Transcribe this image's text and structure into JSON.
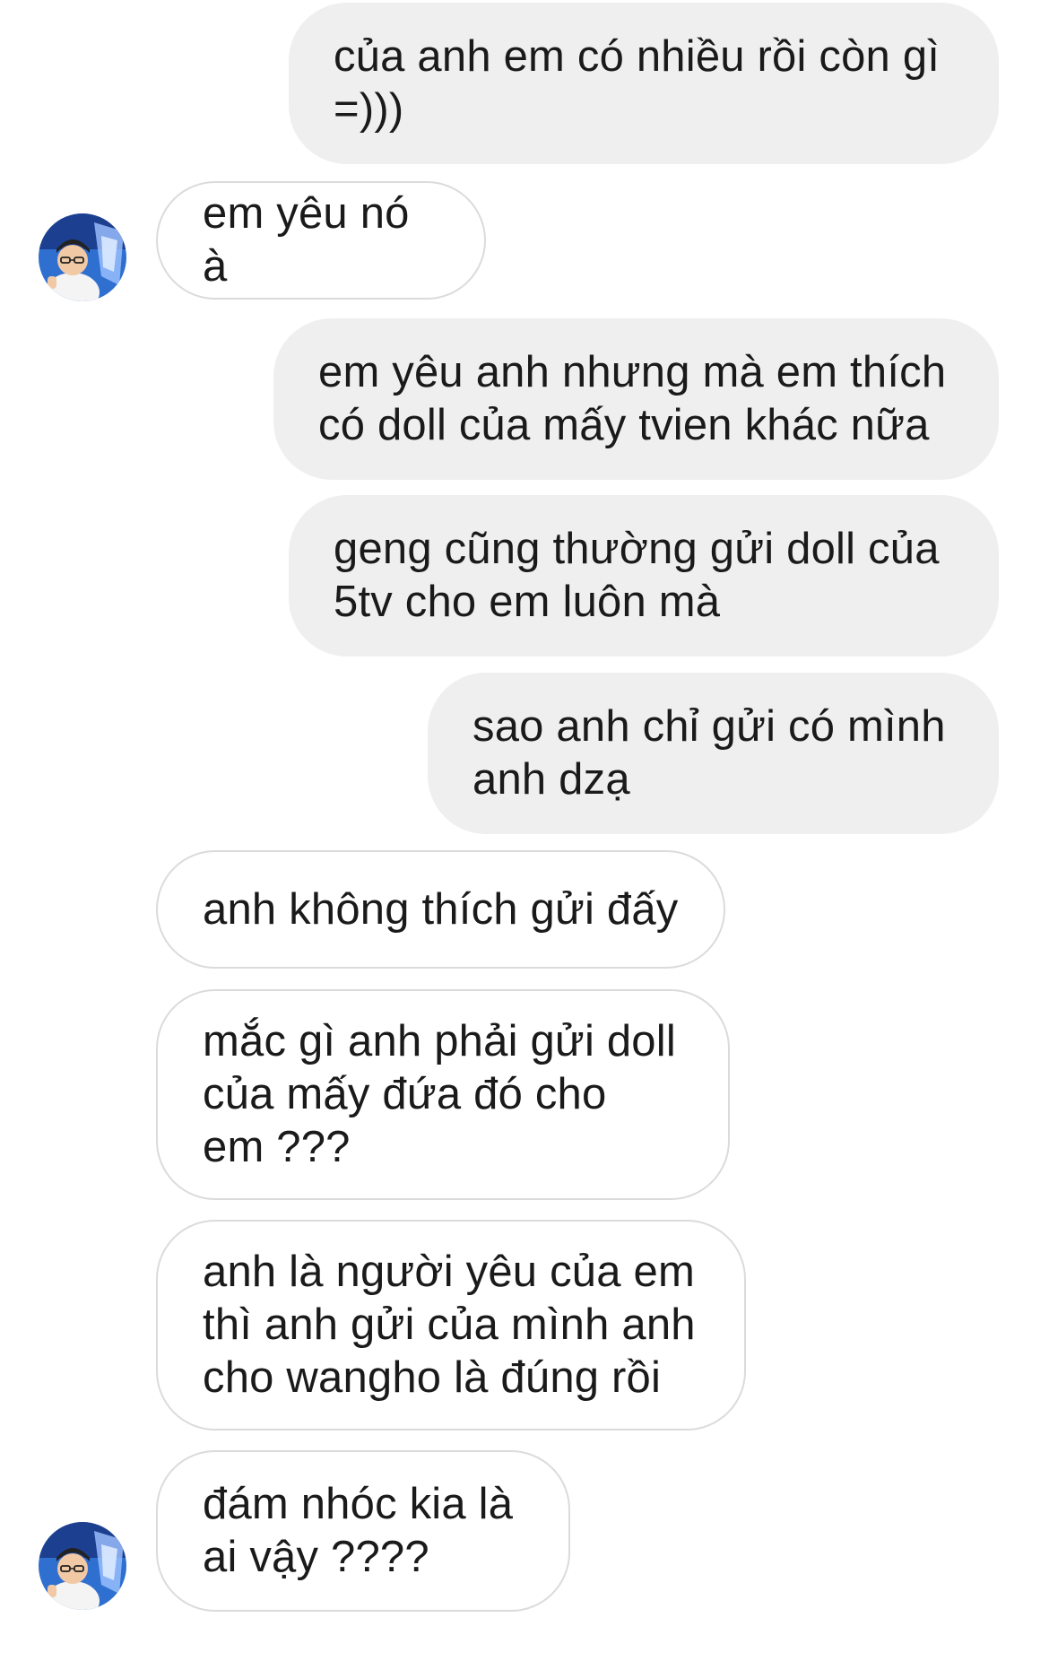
{
  "conversation": {
    "messages": [
      {
        "id": "m1",
        "sender": "me",
        "text": "của anh em có nhiều rồi còn gì\n=)))"
      },
      {
        "id": "m2",
        "sender": "other",
        "text": "em yêu nó à"
      },
      {
        "id": "m3",
        "sender": "me",
        "text": "em yêu anh nhưng mà em thích\ncó doll của mấy tvien khác nữa"
      },
      {
        "id": "m4",
        "sender": "me",
        "text": "geng cũng thường gửi doll của\n5tv cho em luôn mà"
      },
      {
        "id": "m5",
        "sender": "me",
        "text": "sao anh chỉ gửi có mình\nanh dzạ"
      },
      {
        "id": "m6",
        "sender": "other",
        "text": "anh không thích gửi đấy"
      },
      {
        "id": "m7",
        "sender": "other",
        "text": "mắc gì anh phải gửi doll\ncủa mấy đứa đó cho\nem ???"
      },
      {
        "id": "m8",
        "sender": "other",
        "text": "anh là người yêu của em\nthì anh gửi của mình anh\ncho wangho là đúng rồi"
      },
      {
        "id": "m9",
        "sender": "other",
        "text": "đám nhóc kia là\nai vậy ????"
      }
    ]
  },
  "colors": {
    "outgoing_bubble": "#efefef",
    "incoming_border": "#dbdbdb",
    "text": "#1a1a1a",
    "background": "#ffffff"
  },
  "icons": {
    "avatar": "contact-avatar-photo"
  }
}
